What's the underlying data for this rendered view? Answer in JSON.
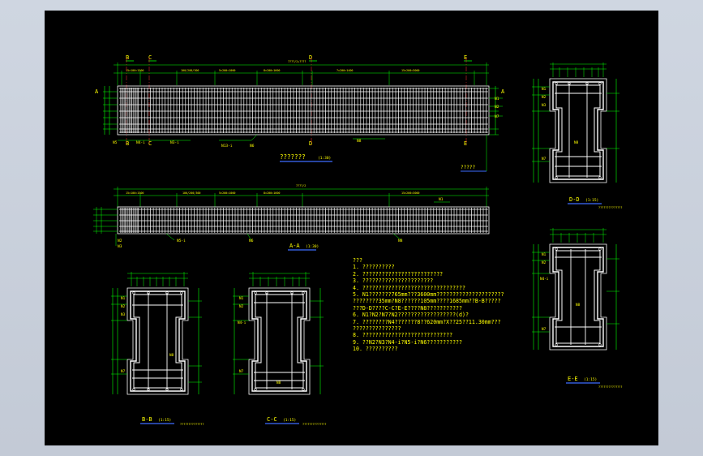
{
  "drawing": {
    "elevation": {
      "section_marks": [
        "B",
        "C",
        "D",
        "E"
      ],
      "end_marks": [
        "A",
        "A"
      ],
      "title": "???????",
      "scale": "(1:30)",
      "note": "?????",
      "bar_labels_left": [
        "N5",
        "N4-i",
        "N3-i",
        "N13-i",
        "N6",
        "N8"
      ],
      "bar_labels_right": [
        "N1",
        "N2",
        "N7"
      ]
    },
    "plan": {
      "title": "A-A",
      "scale": "(1:30)",
      "bar_labels": [
        "N1",
        "N2",
        "N3",
        "N5-i",
        "N6",
        "N8"
      ]
    },
    "sections": [
      {
        "id": "B-B",
        "title": "B-B",
        "scale": "(1:15)",
        "caption": "??????????????"
      },
      {
        "id": "C-C",
        "title": "C-C",
        "scale": "(1:15)",
        "caption": "??????????????"
      },
      {
        "id": "D-D",
        "title": "D-D",
        "scale": "(1:15)",
        "caption": "??????????????"
      },
      {
        "id": "E-E",
        "title": "E-E",
        "scale": "(1:15)",
        "caption": "??????????????"
      }
    ],
    "section_bar_labels": [
      "N1",
      "N2",
      "N3",
      "N4-i",
      "N7",
      "N8"
    ],
    "notes": {
      "heading": "???",
      "items": [
        "1.  ??????????",
        "2.  ?????????????????????????",
        "3.  ??????????????????????",
        "4.  ????????????????????????????????",
        "5.  N1???????765mm???3600mm?????????????????????",
        "      ????????35mm?N8??????105mm????1685mm??B-B?????",
        "      ???D-D????C-C?E-E????N8???????????",
        "6.  N1?N2?N7?N2??????????????????(d)?",
        "7.  ????????N4???????8??620mm?X??25??11.30mm???",
        "      ???????????????",
        "8.  ????????????????????????????",
        "9.  ??N2?N3?N4-i?N5-i?N6???????????",
        "10.  ??????????"
      ]
    },
    "colors": {
      "background": "#000000",
      "rebar": "#ffffff",
      "dimension": "#00ff00",
      "text": "#ffff00",
      "section_line": "#ff3030",
      "title_underline": "#3c6cff"
    }
  }
}
